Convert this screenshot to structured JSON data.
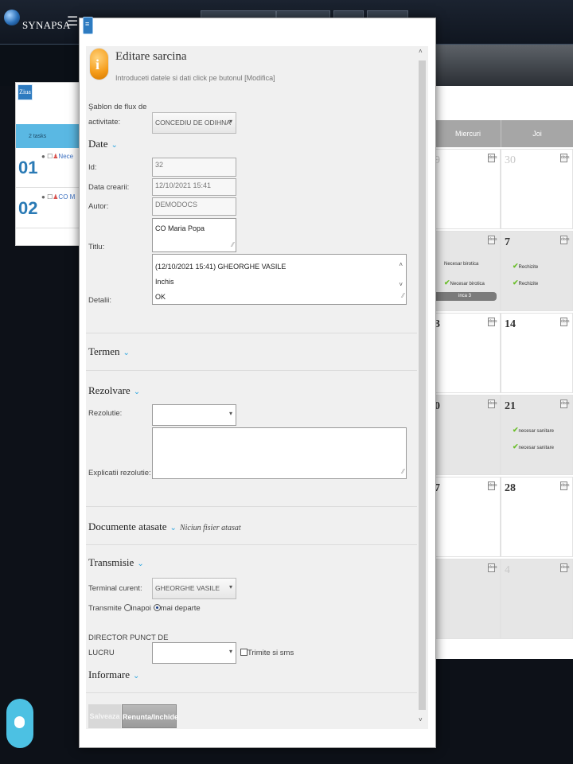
{
  "app": {
    "brand": "SYNAPSA",
    "menu_icon": "hamburger-icon",
    "day_view_label": "Ziua"
  },
  "left_panel": {
    "tasks_label": "2 tasks",
    "rows": [
      {
        "day": "01",
        "preview": "Nece"
      },
      {
        "day": "02",
        "preview": "CO M"
      }
    ]
  },
  "calendar": {
    "headers": [
      "Miercuri",
      "Joi"
    ],
    "icon_text": "docs",
    "weeks": [
      {
        "left_day": "9",
        "right_day": "30",
        "left_light": true,
        "right_light": true,
        "left_events": [],
        "right_events": [],
        "gray": false
      },
      {
        "left_day": "",
        "right_day": "7",
        "left_events": [
          "Necesar birotica",
          "Necesar birotica"
        ],
        "right_events": [
          "Rechizite",
          "Rechizite"
        ],
        "pill": "inca 3",
        "gray": true
      },
      {
        "left_day": "3",
        "right_day": "14",
        "left_events": [],
        "right_events": [],
        "gray": false
      },
      {
        "left_day": "0",
        "right_day": "21",
        "left_events": [],
        "right_events": [
          "necesar sanitare",
          "necesar sanitare"
        ],
        "gray": true
      },
      {
        "left_day": "7",
        "right_day": "28",
        "left_events": [],
        "right_events": [],
        "gray": false
      },
      {
        "left_day": "",
        "right_day": "4",
        "right_light": true,
        "left_events": [],
        "right_events": [],
        "gray": true
      }
    ]
  },
  "modal": {
    "title": "Editare sarcina",
    "subtitle": "Introduceti datele si dati click pe butonul [Modifica]",
    "workflow_template": {
      "label_line1": "Şablon de flux de",
      "label_line2": "activitate:",
      "value": "CONCEDIU DE ODIHNA"
    },
    "sections": {
      "date": "Date",
      "termen": "Termen",
      "rezolvare": "Rezolvare",
      "documente": "Documente atasate",
      "documente_note": "Niciun fisier atasat",
      "transmisie": "Transmisie",
      "informare": "Informare"
    },
    "fields": {
      "id": {
        "label": "Id:",
        "value": "32"
      },
      "created": {
        "label": "Data crearii:",
        "value": "12/10/2021 15:41"
      },
      "author": {
        "label": "Autor:",
        "value": "DEMODOCS"
      },
      "title": {
        "label": "Titlu:",
        "value": "CO Maria Popa"
      },
      "details": {
        "label": "Detalii:",
        "lines": [
          "(12/10/2021 15:41) GHEORGHE VASILE",
          "Inchis",
          "OK"
        ]
      },
      "resolution": {
        "label": "Rezolutie:",
        "value": ""
      },
      "resolution_expl": {
        "label": "Explicatii rezolutie:",
        "value": ""
      },
      "current_terminal": {
        "label": "Terminal curent:",
        "value": "GHEORGHE VASILE"
      },
      "transmit": {
        "label": "Transmite",
        "opt_back": "inapoi",
        "opt_forward": "mai departe",
        "selected": "mai departe"
      },
      "director": {
        "label_line1": "DIRECTOR PUNCT DE",
        "label_line2": "LUCRU",
        "value": "",
        "sms_label": "Trimite si sms"
      }
    },
    "buttons": {
      "save": "Salveaza",
      "cancel": "Renunta/Inchide"
    }
  }
}
